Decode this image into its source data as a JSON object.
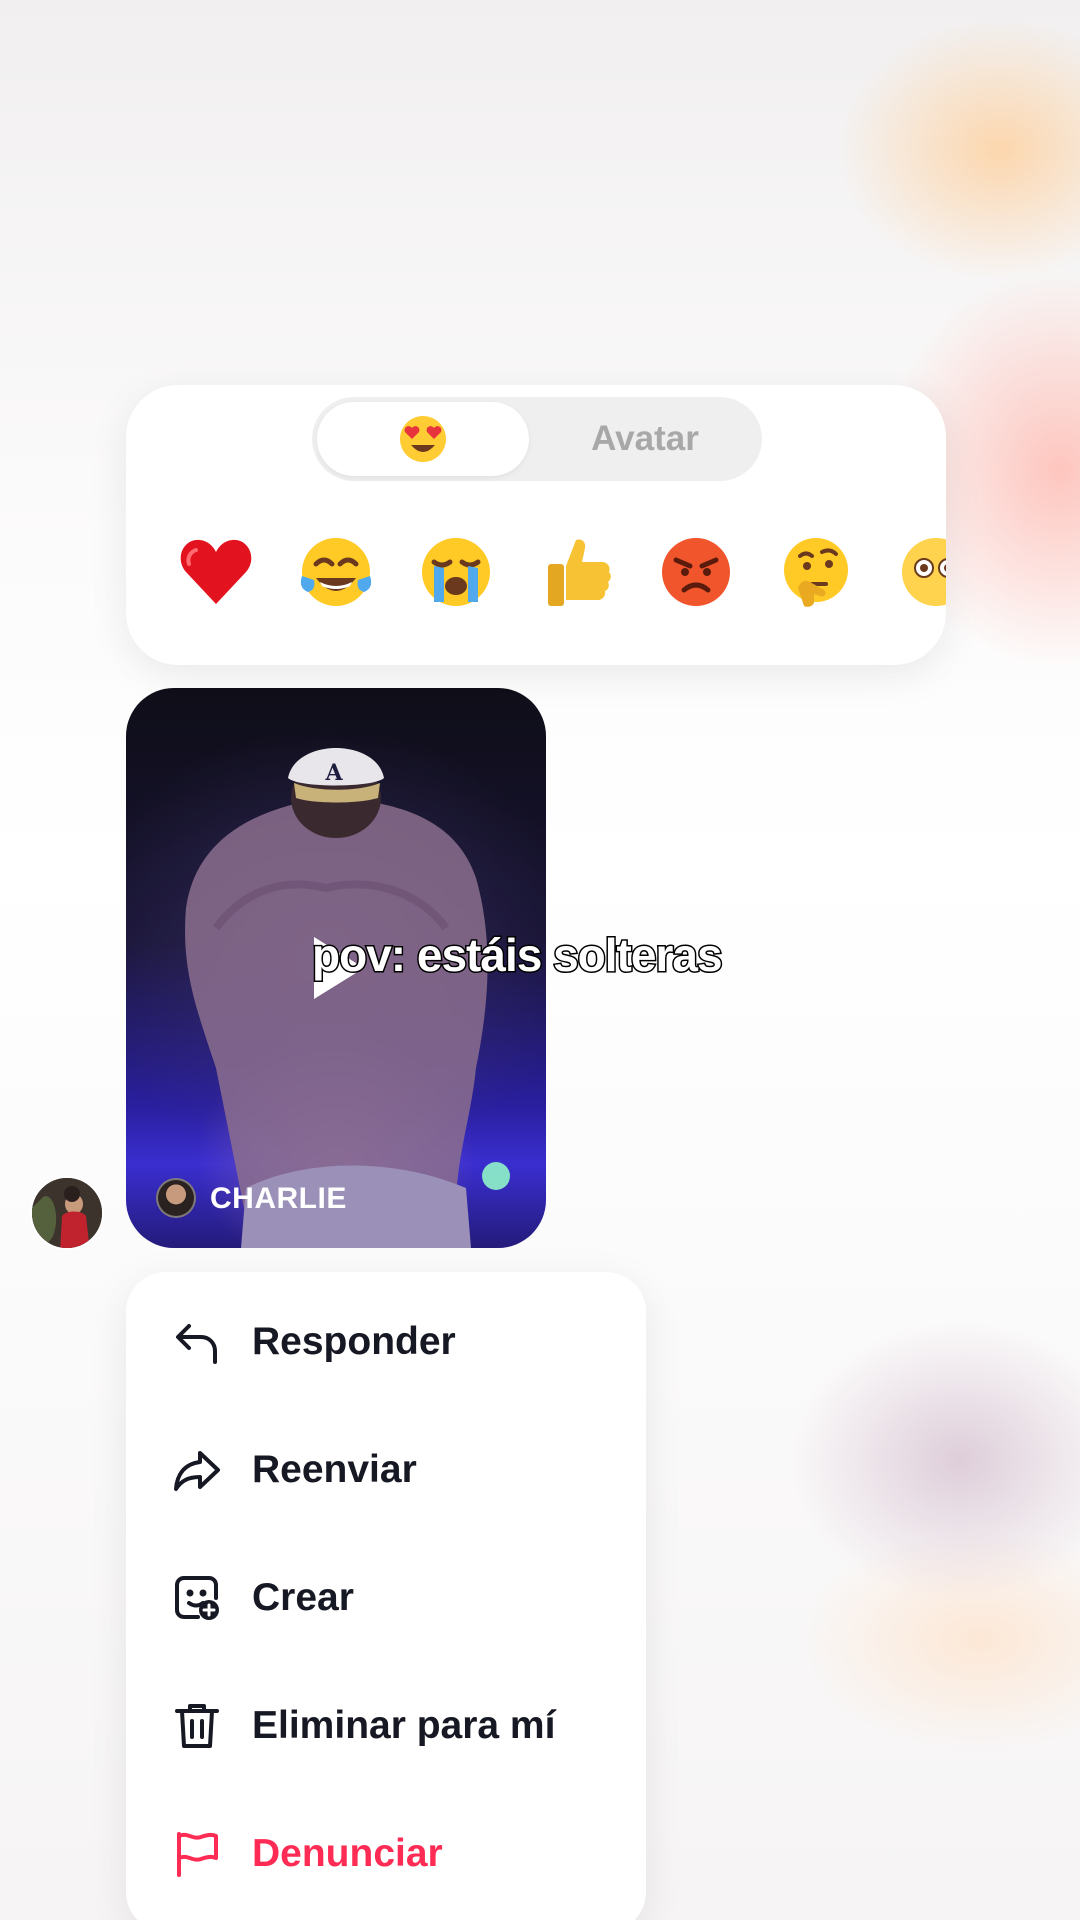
{
  "reaction_panel": {
    "tabs": [
      {
        "label": "😍",
        "icon": "heart-eyes-emoji-icon",
        "selected": true
      },
      {
        "label": "Avatar",
        "selected": false
      }
    ],
    "emojis": [
      {
        "name": "red-heart-emoji",
        "char": "❤️"
      },
      {
        "name": "tears-of-joy-emoji",
        "char": "😂"
      },
      {
        "name": "loudly-crying-emoji",
        "char": "😭"
      },
      {
        "name": "thumbs-up-emoji",
        "char": "👍"
      },
      {
        "name": "angry-face-emoji",
        "char": "😡"
      },
      {
        "name": "thinking-face-emoji",
        "char": "🤔"
      },
      {
        "name": "flushed-face-emoji",
        "char": "😳"
      }
    ]
  },
  "video_message": {
    "caption": "pov: estáis solteras",
    "author": "CHARLIE",
    "play_icon": "play-icon"
  },
  "action_menu": {
    "items": [
      {
        "name": "reply",
        "icon": "reply-arrow-icon",
        "label": "Responder"
      },
      {
        "name": "forward",
        "icon": "share-arrow-icon",
        "label": "Reenviar"
      },
      {
        "name": "create",
        "icon": "sticker-add-icon",
        "label": "Crear"
      },
      {
        "name": "delete-for-me",
        "icon": "trash-icon",
        "label": "Eliminar para mí"
      },
      {
        "name": "report",
        "icon": "flag-icon",
        "label": "Denunciar",
        "color": "#fe2c55"
      }
    ]
  },
  "colors": {
    "danger": "#fe2c55",
    "text": "#161823",
    "muted": "#a8a8a8"
  }
}
